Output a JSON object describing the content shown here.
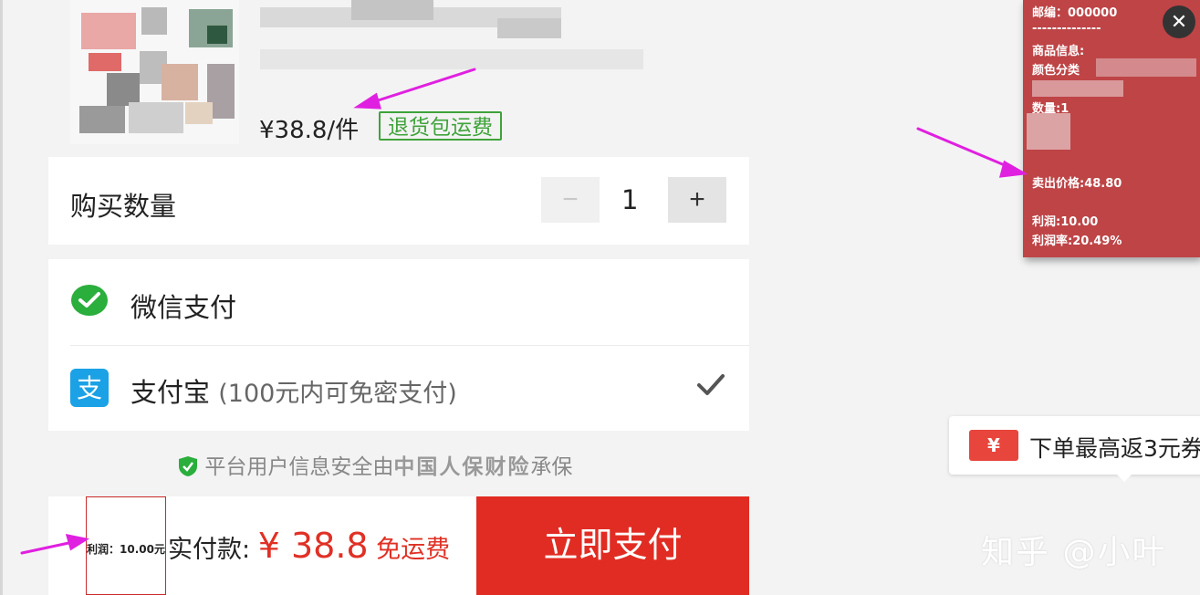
{
  "product": {
    "price": "¥38.8/件",
    "refund_badge": "退货包运费"
  },
  "quantity": {
    "label": "购买数量",
    "minus": "−",
    "value": "1",
    "plus": "+"
  },
  "payment": {
    "wechat_label": "微信支付",
    "alipay_label": "支付宝",
    "alipay_note": "(100元内可免密支付)"
  },
  "insurance": {
    "prefix": "平台用户信息安全由",
    "company": "中国人保财险",
    "suffix": "承保"
  },
  "footer": {
    "profit_tag": "利润：10.00元",
    "pay_label": "实付款:",
    "amount": "¥ 38.8",
    "free_shipping": "免运费",
    "pay_button": "立即支付"
  },
  "overlay": {
    "postcode": "邮编：000000",
    "separator": "--------------",
    "goods_info": "商品信息:",
    "color_category": "颜色分类",
    "quantity": "数量:1",
    "sell_price": "卖出价格:48.80",
    "profit": "利润:10.00",
    "profit_rate": "利润率:20.49%",
    "close": "✕"
  },
  "promo": {
    "icon": "¥",
    "text": "下单最高返3元券"
  },
  "watermark": "知乎 @小叶",
  "colors": {
    "accent_red": "#e12c23",
    "badge_green": "#3fa33a",
    "overlay_bg": "#be4446",
    "arrow_magenta": "#e020e0"
  },
  "icons": {
    "wechat": "wechat-pay-icon",
    "alipay": "alipay-icon",
    "check": "checkmark-icon",
    "shield": "shield-check-icon",
    "close": "close-icon",
    "coupon": "coupon-icon"
  }
}
